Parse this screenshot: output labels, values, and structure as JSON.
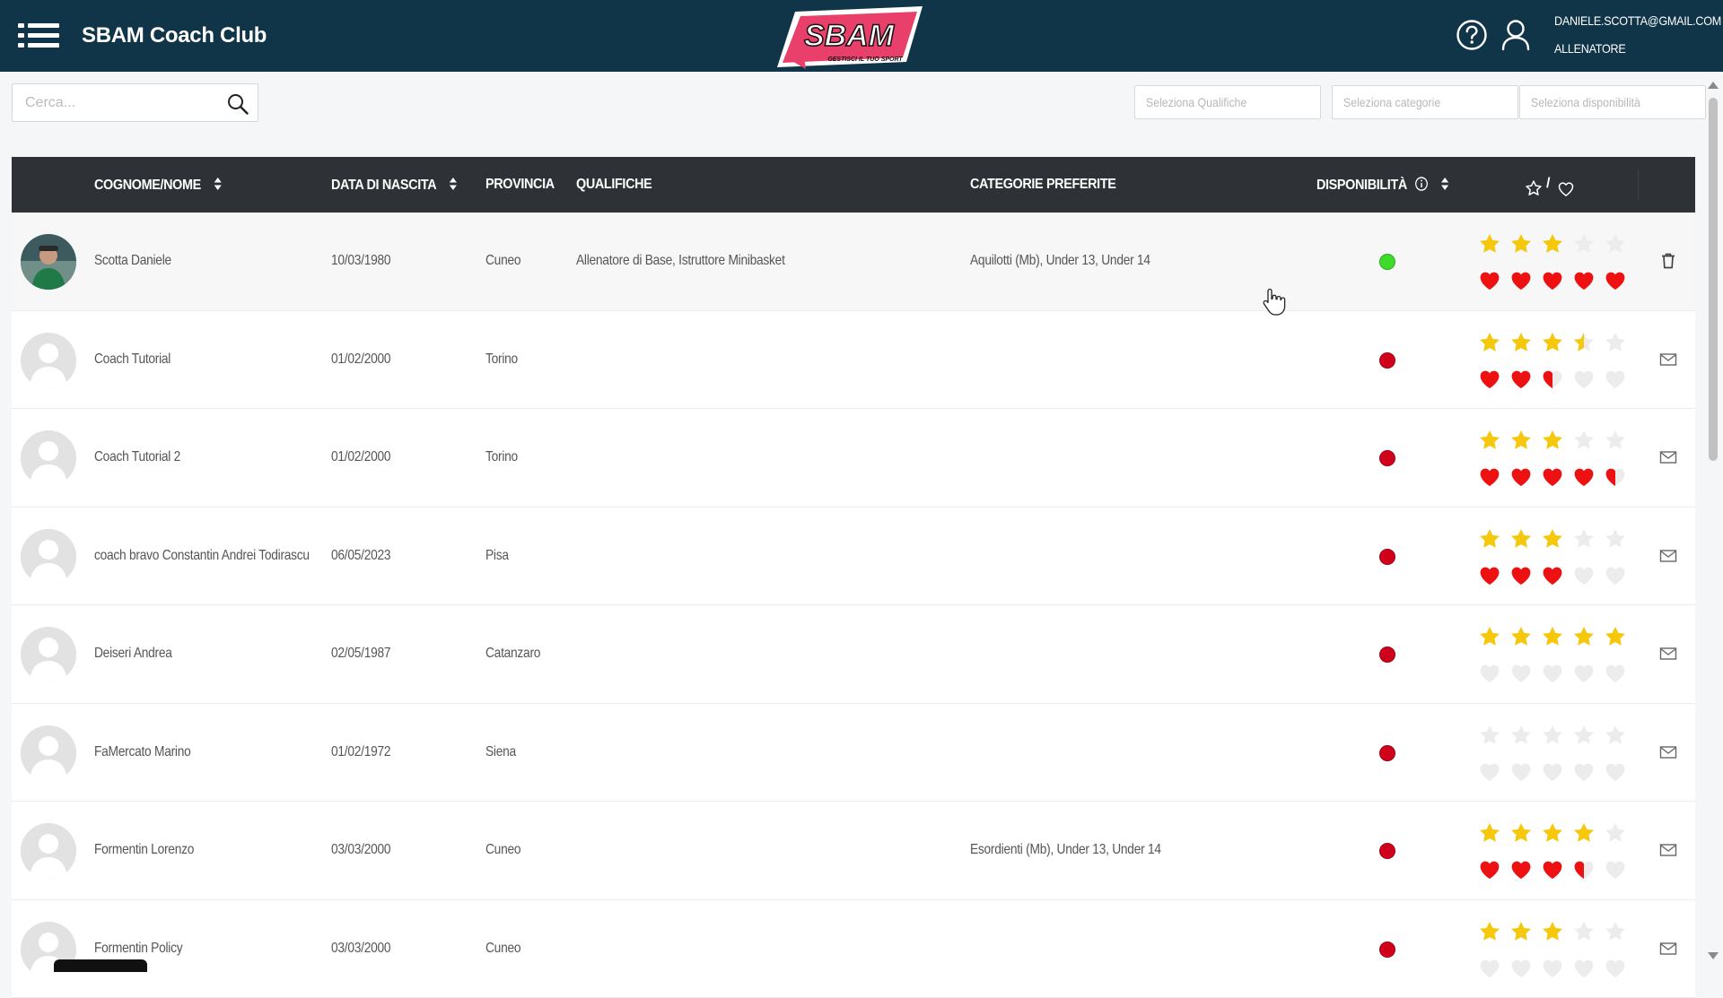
{
  "header": {
    "title": "SBAM Coach Club",
    "logo_text": "SBAM",
    "logo_tagline": "GESTISCI IL TUO SPORT",
    "user_email": "DANIELE.SCOTTA@GMAIL.COM",
    "user_role": "ALLENATORE"
  },
  "search": {
    "placeholder": "Cerca..."
  },
  "filters": [
    {
      "placeholder": "Seleziona Qualifiche"
    },
    {
      "placeholder": "Seleziona categorie"
    },
    {
      "placeholder": "Seleziona disponibilità"
    }
  ],
  "columns": {
    "name": "COGNOME/NOME",
    "birth": "DATA DI NASCITA",
    "province": "PROVINCIA",
    "qualifications": "QUALIFICHE",
    "categories": "CATEGORIE PREFERITE",
    "availability": "DISPONIBILITÀ",
    "rating_separator": "/"
  },
  "colors": {
    "header_bg": "#113548",
    "table_head_bg": "#2e3236",
    "star": "#f5c80b",
    "heart": "#ee1111",
    "available": "#3ddc2a",
    "unavailable": "#d0021b"
  },
  "rows": [
    {
      "name": "Scotta Daniele",
      "birth": "10/03/1980",
      "province": "Cuneo",
      "qualifications": "Allenatore di Base, Istruttore Minibasket",
      "categories": "Aquilotti (Mb), Under 13, Under 14",
      "available": true,
      "stars": 3,
      "hearts": 5,
      "avatar": "photo",
      "action": "trash-icon"
    },
    {
      "name": "Coach Tutorial",
      "birth": "01/02/2000",
      "province": "Torino",
      "qualifications": "",
      "categories": "",
      "available": false,
      "stars": 3.5,
      "hearts": 2.5,
      "avatar": "placeholder",
      "action": "mail-icon"
    },
    {
      "name": "Coach Tutorial 2",
      "birth": "01/02/2000",
      "province": "Torino",
      "qualifications": "",
      "categories": "",
      "available": false,
      "stars": 3,
      "hearts": 4.5,
      "avatar": "placeholder",
      "action": "mail-icon"
    },
    {
      "name": "coach bravo Constantin Andrei Todirascu",
      "birth": "06/05/2023",
      "province": "Pisa",
      "qualifications": "",
      "categories": "",
      "available": false,
      "stars": 3,
      "hearts": 3,
      "avatar": "placeholder",
      "action": "mail-icon"
    },
    {
      "name": "Deiseri Andrea",
      "birth": "02/05/1987",
      "province": "Catanzaro",
      "qualifications": "",
      "categories": "",
      "available": false,
      "stars": 5,
      "hearts": 0,
      "avatar": "placeholder",
      "action": "mail-icon"
    },
    {
      "name": "FaMercato Marino",
      "birth": "01/02/1972",
      "province": "Siena",
      "qualifications": "",
      "categories": "",
      "available": false,
      "stars": 0,
      "hearts": 0,
      "avatar": "placeholder",
      "action": "mail-icon"
    },
    {
      "name": "Formentin Lorenzo",
      "birth": "03/03/2000",
      "province": "Cuneo",
      "qualifications": "",
      "categories": "Esordienti (Mb), Under 13, Under 14",
      "available": false,
      "stars": 4,
      "hearts": 3.5,
      "avatar": "placeholder",
      "action": "mail-icon"
    },
    {
      "name": "Formentin Policy",
      "birth": "03/03/2000",
      "province": "Cuneo",
      "qualifications": "",
      "categories": "",
      "available": false,
      "stars": 3,
      "hearts": 0,
      "avatar": "placeholder",
      "action": "mail-icon"
    }
  ]
}
